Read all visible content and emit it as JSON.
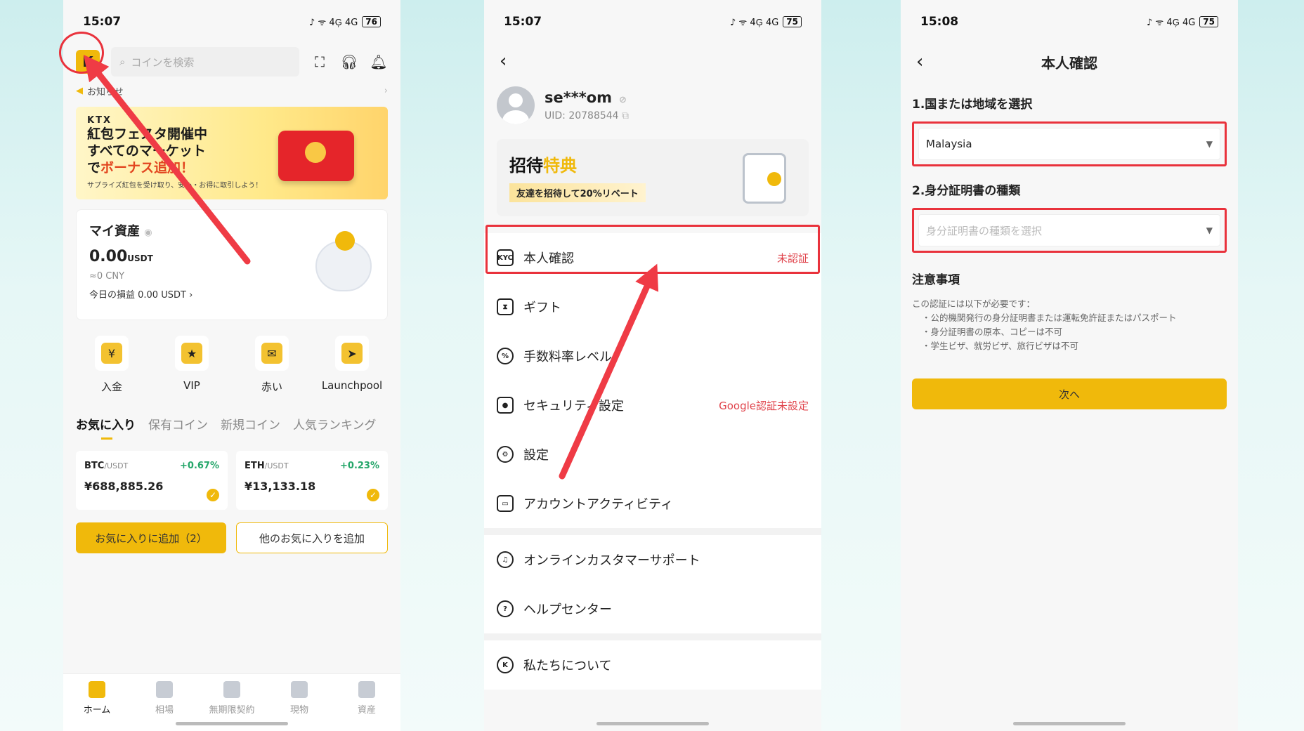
{
  "p1": {
    "status": {
      "time": "15:07",
      "icons": "♪ ᯤ 4G᷊ 4G",
      "battery": "76"
    },
    "search": {
      "placeholder": "コインを検索"
    },
    "notice": "お知らせ",
    "banner": {
      "brand": "KTX",
      "line1": "紅包フェスタ開催中",
      "line2": "すべてのマーケット",
      "line3a": "で",
      "line3b": "ボーナス追加！",
      "line4": "サプライズ紅包を受け取り、安心・お得に取引しよう！"
    },
    "asset": {
      "title": "マイ資産",
      "value": "0.00",
      "unit": "USDT",
      "cny": "≈0 CNY",
      "pl": "今日の損益 0.00 USDT"
    },
    "quick": [
      {
        "label": "入金",
        "icon": "deposit-icon"
      },
      {
        "label": "VIP",
        "icon": "vip-icon"
      },
      {
        "label": "赤い",
        "icon": "red-packet-icon"
      },
      {
        "label": "Launchpool",
        "icon": "launchpool-icon"
      }
    ],
    "tabs": [
      "お気に入り",
      "保有コイン",
      "新規コイン",
      "人気ランキング"
    ],
    "pairs": [
      {
        "base": "BTC",
        "quote": "/USDT",
        "change": "+0.67%",
        "price": "¥688,885.26"
      },
      {
        "base": "ETH",
        "quote": "/USDT",
        "change": "+0.23%",
        "price": "¥13,133.18"
      }
    ],
    "btn_add": "お気に入りに追加（2）",
    "btn_other": "他のお気に入りを追加",
    "nav": [
      "ホーム",
      "相場",
      "無期限契約",
      "現物",
      "資産"
    ]
  },
  "p2": {
    "status": {
      "time": "15:07",
      "icons": "♪ ᯤ 4G᷊ 4G",
      "battery": "75"
    },
    "user": {
      "name": "se***om",
      "uid": "UID: 20788544"
    },
    "invite": {
      "title_a": "招待",
      "title_b": "特典",
      "sub": "友達を招待して20%リベート"
    },
    "menu": [
      {
        "label": "本人確認",
        "right": "未認証",
        "icon": "KYC"
      },
      {
        "label": "ギフト",
        "right": "",
        "icon": "gift"
      },
      {
        "label": "手数料率レベル",
        "right": "",
        "icon": "%"
      },
      {
        "label": "セキュリティ設定",
        "right": "Google認証未設定",
        "icon": "lock"
      },
      {
        "label": "設定",
        "right": "",
        "icon": "gear"
      },
      {
        "label": "アカウントアクティビティ",
        "right": "",
        "icon": "monitor"
      }
    ],
    "menu2": [
      {
        "label": "オンラインカスタマーサポート",
        "icon": "headset"
      },
      {
        "label": "ヘルプセンター",
        "icon": "?"
      }
    ],
    "menu3": [
      {
        "label": "私たちについて",
        "icon": "logo"
      }
    ]
  },
  "p3": {
    "status": {
      "time": "15:08",
      "icons": "♪ ᯤ 4G᷊ 4G",
      "battery": "75"
    },
    "title": "本人確認",
    "step1": "1.国または地域を選択",
    "country": "Malaysia",
    "step2": "2.身分証明書の種類",
    "doc_placeholder": "身分証明書の種類を選択",
    "notes_title": "注意事項",
    "notes_intro": "この認証には以下が必要です：",
    "notes": [
      "・公的機関発行の身分証明書または運転免許証またはパスポート",
      "・身分証明書の原本、コピーは不可",
      "・学生ビザ、就労ビザ、旅行ビザは不可"
    ],
    "next": "次へ"
  },
  "colors": {
    "accent": "#f0b90b",
    "highlight": "#e9323c",
    "positive": "#25a66a"
  }
}
